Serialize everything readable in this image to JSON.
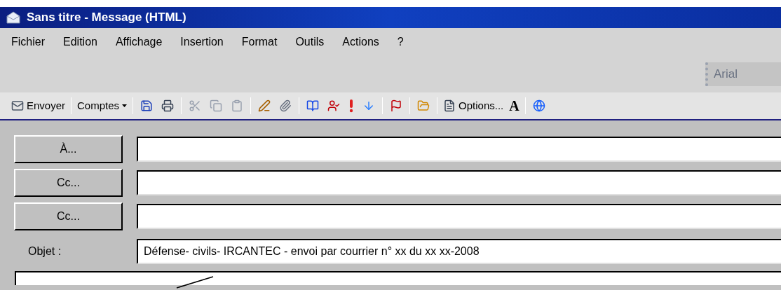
{
  "window": {
    "title": "Sans titre - Message (HTML)"
  },
  "menu": [
    "Fichier",
    "Edition",
    "Affichage",
    "Insertion",
    "Format",
    "Outils",
    "Actions",
    "?"
  ],
  "font_box": {
    "value": "Arial"
  },
  "toolbar": [
    {
      "kind": "text",
      "label": "Envoyer"
    },
    {
      "kind": "sep"
    },
    {
      "kind": "dropdown",
      "label": "Comptes"
    },
    {
      "kind": "sep"
    },
    {
      "kind": "icon"
    },
    {
      "kind": "icon"
    },
    {
      "kind": "sep"
    },
    {
      "kind": "icon"
    },
    {
      "kind": "icon"
    },
    {
      "kind": "icon"
    },
    {
      "kind": "sep"
    },
    {
      "kind": "icon"
    },
    {
      "kind": "icon"
    },
    {
      "kind": "sep"
    },
    {
      "kind": "icon"
    },
    {
      "kind": "icon"
    },
    {
      "kind": "icon"
    },
    {
      "kind": "icon"
    },
    {
      "kind": "sep"
    },
    {
      "kind": "icon"
    },
    {
      "kind": "sep"
    },
    {
      "kind": "icon"
    },
    {
      "kind": "sep"
    },
    {
      "kind": "text",
      "label": "Options..."
    },
    {
      "kind": "glyph",
      "label": "A"
    },
    {
      "kind": "sep"
    },
    {
      "kind": "icon"
    }
  ],
  "recipients": [
    {
      "label": "À..."
    },
    {
      "label": "Cc..."
    },
    {
      "label": "Cc..."
    }
  ],
  "subject": {
    "label": "Objet :",
    "value": "Défense- civils- IRCANTEC - envoi par courrier n° xx du xx xx-2008"
  }
}
